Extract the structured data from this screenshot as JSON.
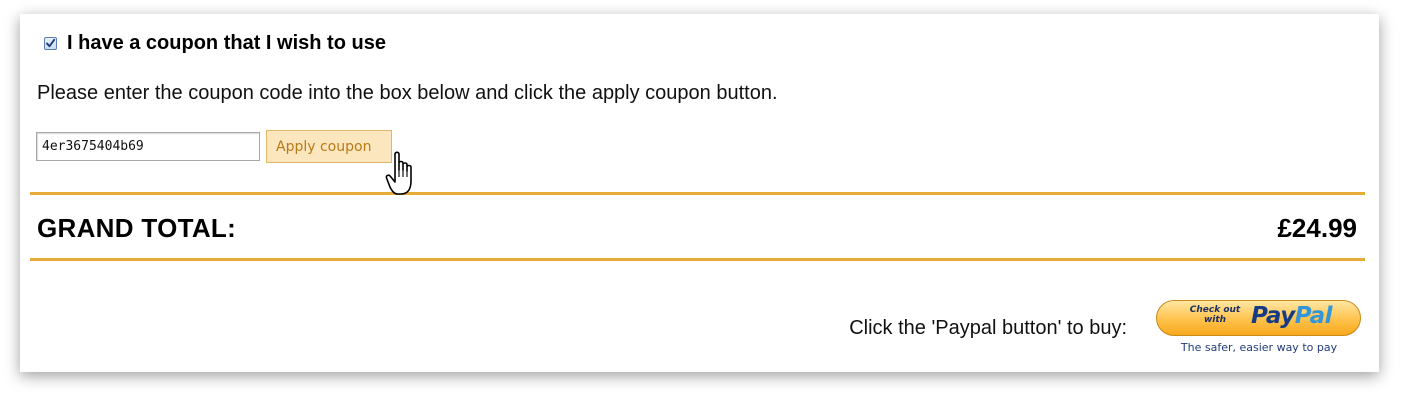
{
  "coupon": {
    "checked": true,
    "label": "I have a coupon that I wish to use",
    "instructions": "Please enter the coupon code into the box below and click the apply coupon button.",
    "code_value": "4er3675404b69",
    "apply_label": "Apply coupon"
  },
  "total": {
    "label": "GRAND TOTAL:",
    "value": "£24.99"
  },
  "checkout": {
    "buy_text": "Click the 'Paypal button' to buy:",
    "paypal": {
      "check_out": "Check out",
      "with": "with",
      "brand_pay": "Pay",
      "brand_pal": "Pal",
      "tagline": "The safer, easier way to pay"
    }
  },
  "colors": {
    "accent_rule": "#e6ac37",
    "apply_bg": "#fce6bd",
    "apply_text": "#b77a18",
    "paypal_orange": "#ffc24b",
    "paypal_navy": "#173c84",
    "paypal_blue": "#3296d8"
  },
  "icons": {
    "checkbox": "checkmark-icon",
    "cursor": "hand-pointer-cursor-icon"
  }
}
